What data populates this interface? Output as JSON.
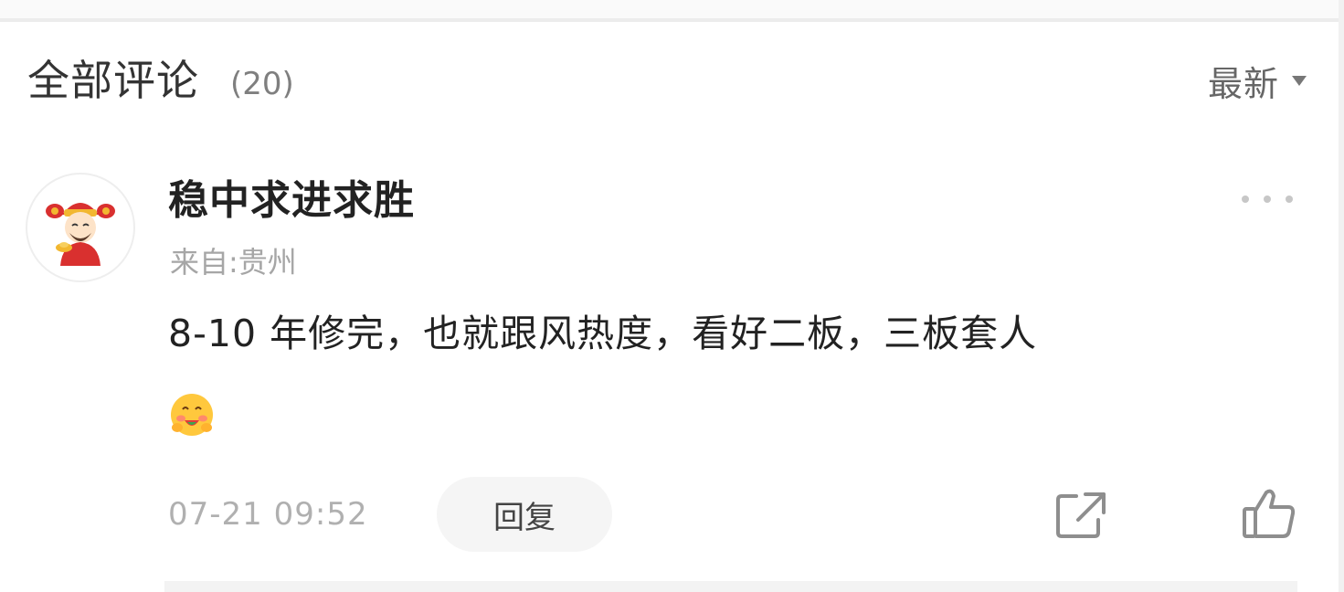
{
  "comments_section": {
    "title": "全部评论",
    "count": "(20)",
    "sort_label": "最新"
  },
  "comment": {
    "username": "稳中求进求胜",
    "location": "来自:贵州",
    "text": "8-10 年修完，也就跟风热度，看好二板，三板套人",
    "emoji": "yum-face-emoji",
    "timestamp": "07-21 09:52",
    "reply_label": "回复"
  },
  "icons": {
    "more": "more-dots-icon",
    "sort": "caret-down-icon",
    "share": "share-icon",
    "like": "thumbs-up-icon",
    "avatar": "god-of-wealth-avatar"
  },
  "colors": {
    "title_text": "#333333",
    "muted_text": "#a6a6a6",
    "reply_bg": "#f5f5f5",
    "avatar_red": "#d9302f",
    "avatar_gold": "#f2b730"
  }
}
